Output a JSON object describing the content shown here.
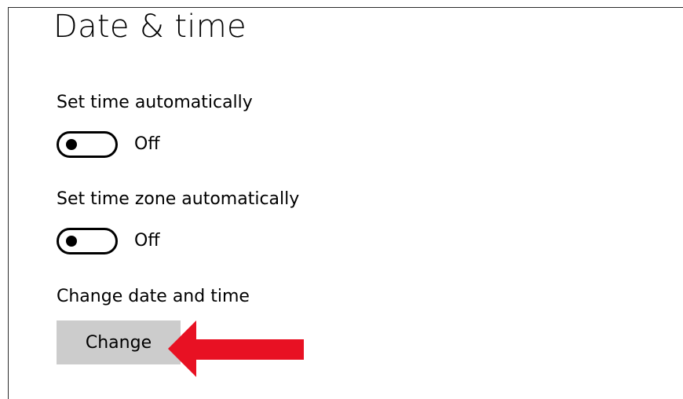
{
  "page": {
    "title": "Date & time"
  },
  "settings": {
    "set_time_auto": {
      "label": "Set time automatically",
      "state": "Off"
    },
    "set_timezone_auto": {
      "label": "Set time zone automatically",
      "state": "Off"
    },
    "change_date_time": {
      "label": "Change date and time",
      "button_label": "Change"
    }
  },
  "annotation": {
    "arrow_icon": "left-arrow-icon",
    "arrow_color": "#e81123"
  },
  "colors": {
    "button_background": "#cccccc",
    "text": "#000000",
    "background": "#ffffff"
  }
}
